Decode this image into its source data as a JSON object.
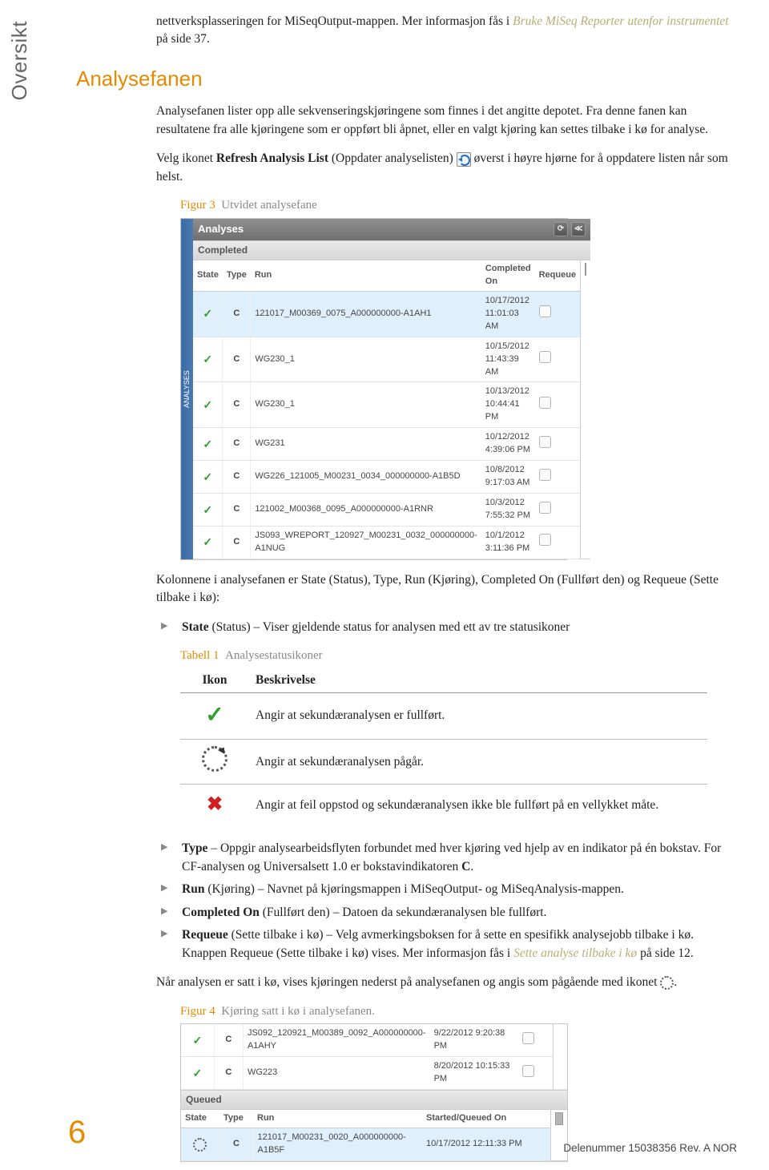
{
  "side_tab": "Oversikt",
  "intro": {
    "pre": "nettverksplasseringen for MiSeqOutput-mappen. Mer informasjon fås i ",
    "link": "Bruke MiSeq Reporter utenfor instrumentet",
    "post": " på side 37."
  },
  "section_title": "Analysefanen",
  "para1": "Analysefanen lister opp alle sekvenseringskjøringene som finnes i det angitte depotet. Fra denne fanen kan resultatene fra alle kjøringene som er oppført bli åpnet, eller en valgt kjøring kan settes tilbake i kø for analyse.",
  "para2": {
    "a": "Velg ikonet ",
    "b": "Refresh Analysis List",
    "c": " (Oppdater analyselisten) ",
    "d": "øverst i høyre hjørne for å oppdatere listen når som helst."
  },
  "fig3": {
    "label": "Figur 3",
    "text": "Utvidet analysefane"
  },
  "ui": {
    "sidebar": "ANALYSES",
    "title": "Analyses",
    "group": "Completed",
    "cols": {
      "state": "State",
      "type": "Type",
      "run": "Run",
      "done": "Completed On",
      "req": "Requeue"
    },
    "rows": [
      {
        "type": "C",
        "run": "121017_M00369_0075_A000000000-A1AH1",
        "done": "10/17/2012 11:01:03 AM"
      },
      {
        "type": "C",
        "run": "WG230_1",
        "done": "10/15/2012 11:43:39 AM"
      },
      {
        "type": "C",
        "run": "WG230_1",
        "done": "10/13/2012 10:44:41 PM"
      },
      {
        "type": "C",
        "run": "WG231",
        "done": "10/12/2012 4:39:06 PM"
      },
      {
        "type": "C",
        "run": "WG226_121005_M00231_0034_000000000-A1B5D",
        "done": "10/8/2012 9:17:03 AM"
      },
      {
        "type": "C",
        "run": "121002_M00368_0095_A000000000-A1RNR",
        "done": "10/3/2012 7:55:32 PM"
      },
      {
        "type": "C",
        "run": "JS093_WREPORT_120927_M00231_0032_000000000-A1NUG",
        "done": "10/1/2012 3:11:36 PM"
      }
    ]
  },
  "para3": "Kolonnene i analysefanen er State (Status), Type, Run (Kjøring), Completed On (Fullført den) og Requeue (Sette tilbake i kø):",
  "bullet_state": {
    "b": "State",
    "t": " (Status) – Viser gjeldende status for analysen med ett av tre statusikoner"
  },
  "tbl1": {
    "label": "Tabell 1",
    "caption": "Analysestatusikoner",
    "h_icon": "Ikon",
    "h_desc": "Beskrivelse",
    "r1": "Angir at sekundæranalysen er fullført.",
    "r2": "Angir at sekundæranalysen pågår.",
    "r3": "Angir at feil oppstod og sekundæranalysen ikke ble fullført på en vellykket måte."
  },
  "bullets": {
    "type": {
      "b": "Type",
      "t": " – Oppgir analysearbeidsflyten forbundet med hver kjøring ved hjelp av en indikator på én bokstav. For CF-analysen og Universalsett 1.0 er bokstavindikatoren ",
      "c": "C",
      "t2": "."
    },
    "run": {
      "b": "Run",
      "t": " (Kjøring) – Navnet på kjøringsmappen i MiSeqOutput- og MiSeqAnalysis-mappen."
    },
    "done": {
      "b": "Completed On",
      "t": " (Fullført den) – Datoen da sekundæranalysen ble fullført."
    },
    "req": {
      "b": "Requeue",
      "t": " (Sette tilbake i kø) – Velg avmerkingsboksen for å sette en spesifikk analysejobb tilbake i kø. Knappen Requeue (Sette tilbake i kø) vises. Mer informasjon fås i ",
      "link": "Sette analyse tilbake i kø",
      "t2": " på side 12."
    }
  },
  "para4": "Når analysen er satt i kø, vises kjøringen nederst på analysefanen og angis som pågående med ikonet ",
  "para4_end": ".",
  "fig4": {
    "label": "Figur 4",
    "text": "Kjøring satt i kø i analysefanen."
  },
  "ui2": {
    "rows": [
      {
        "type": "C",
        "run": "JS092_120921_M00389_0092_A000000000-A1AHY",
        "done": "9/22/2012 9:20:38 PM"
      },
      {
        "type": "C",
        "run": "WG223",
        "done": "8/20/2012 10:15:33 PM"
      }
    ],
    "queued": "Queued",
    "cols": {
      "state": "State",
      "type": "Type",
      "run": "Run",
      "started": "Started/Queued On"
    },
    "qrow": {
      "type": "C",
      "run": "121017_M00231_0020_A000000000-A1B5F",
      "done": "10/17/2012 12:11:33 PM"
    }
  },
  "footer": {
    "page": "6",
    "rev": "Delenummer 15038356 Rev. A NOR"
  }
}
